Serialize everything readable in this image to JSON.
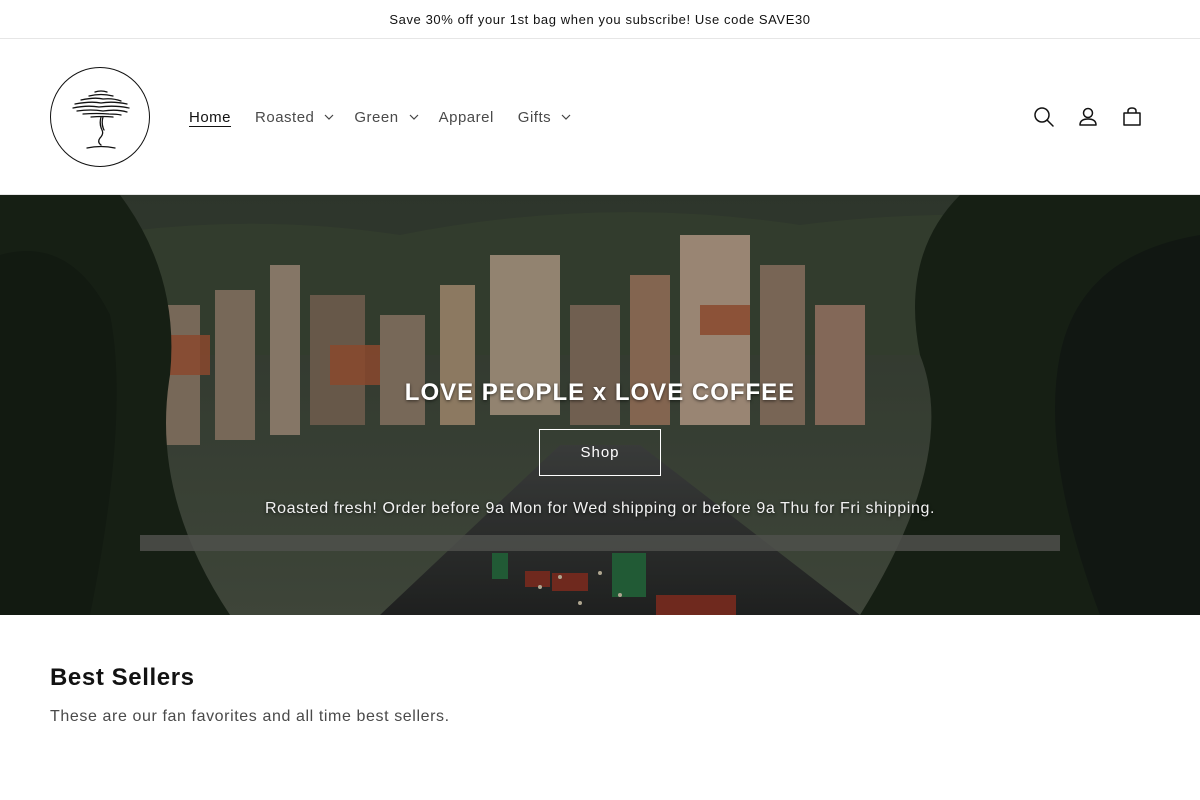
{
  "announcement": {
    "text": "Save 30% off your 1st bag when you subscribe! Use code SAVE30"
  },
  "header": {
    "logo_icon": "tree-logo-icon",
    "nav": [
      {
        "label": "Home",
        "dropdown": false,
        "active": true
      },
      {
        "label": "Roasted",
        "dropdown": true
      },
      {
        "label": "Green",
        "dropdown": true
      },
      {
        "label": "Apparel",
        "dropdown": false
      },
      {
        "label": "Gifts",
        "dropdown": true
      }
    ],
    "icons": [
      "search-icon",
      "account-icon",
      "cart-icon"
    ]
  },
  "hero": {
    "title": "LOVE PEOPLE x LOVE COFFEE",
    "button_label": "Shop",
    "subtitle": "Roasted fresh! Order before 9a Mon for Wed shipping or before 9a Thu for Fri shipping."
  },
  "best_sellers": {
    "title": "Best Sellers",
    "subtitle": "These are our fan favorites and all time best sellers."
  },
  "colors": {
    "text": "#121212",
    "muted": "#4a4a4a",
    "border": "#e6e6e6",
    "hero_overlay": "#000000"
  }
}
